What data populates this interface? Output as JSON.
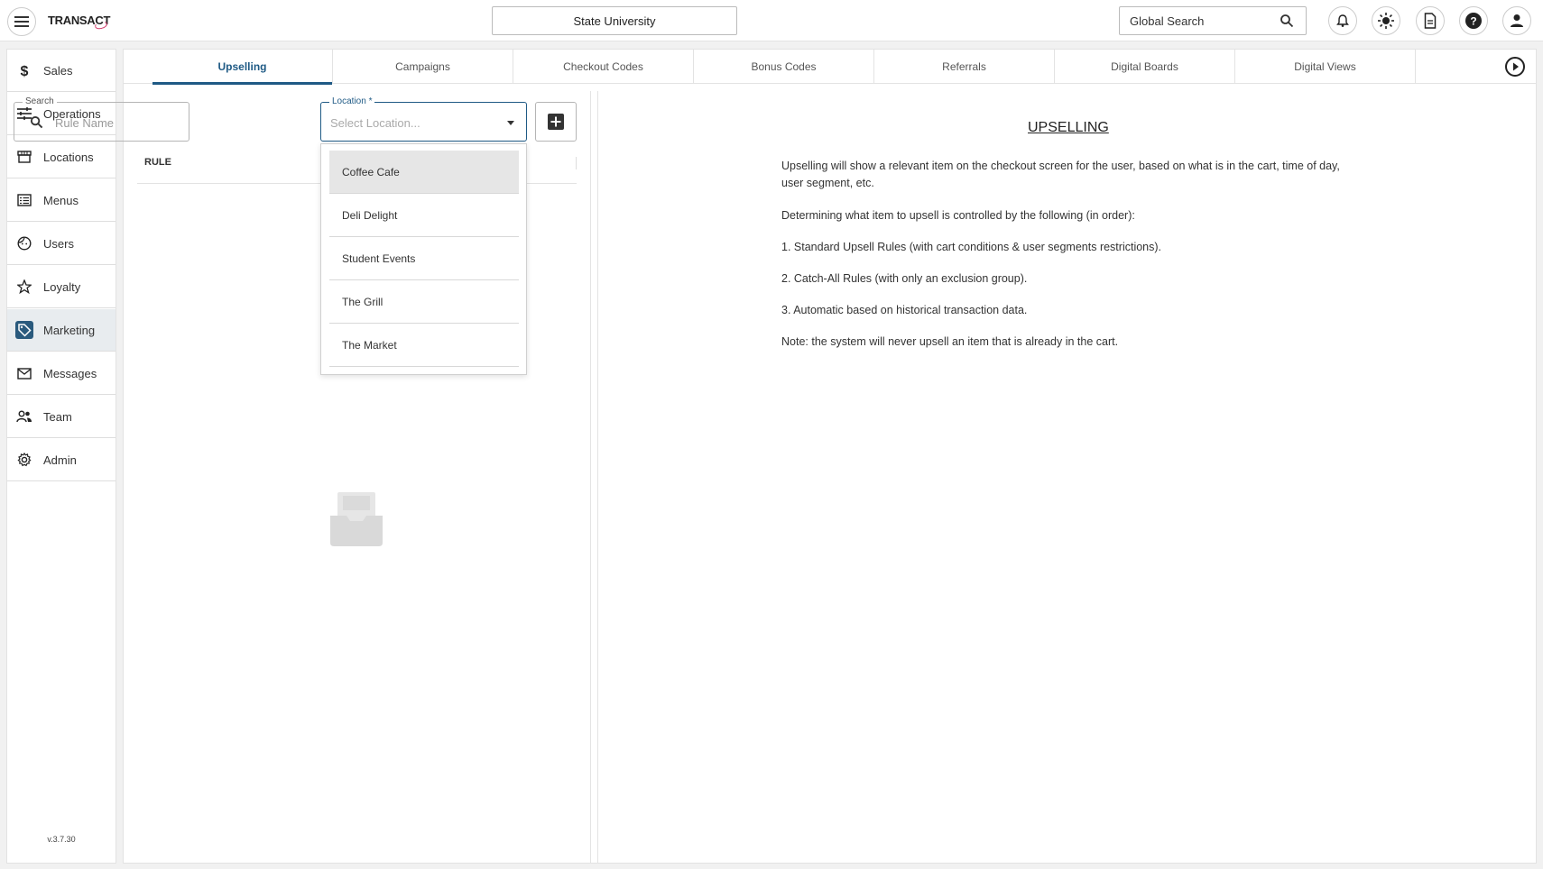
{
  "header": {
    "logo_text": "TRANSACT",
    "org_name": "State University",
    "global_search_placeholder": "Global Search"
  },
  "sidebar": {
    "items": [
      {
        "label": "Sales",
        "icon": "dollar-icon"
      },
      {
        "label": "Operations",
        "icon": "sliders-icon"
      },
      {
        "label": "Locations",
        "icon": "storefront-icon"
      },
      {
        "label": "Menus",
        "icon": "list-icon"
      },
      {
        "label": "Users",
        "icon": "face-icon"
      },
      {
        "label": "Loyalty",
        "icon": "star-icon"
      },
      {
        "label": "Marketing",
        "icon": "tag-icon",
        "active": true
      },
      {
        "label": "Messages",
        "icon": "mail-icon"
      },
      {
        "label": "Team",
        "icon": "people-icon"
      },
      {
        "label": "Admin",
        "icon": "gear-icon"
      }
    ],
    "version": "v.3.7.30"
  },
  "tabs": [
    {
      "label": "Upselling",
      "active": true
    },
    {
      "label": "Campaigns"
    },
    {
      "label": "Checkout Codes"
    },
    {
      "label": "Bonus Codes"
    },
    {
      "label": "Referrals"
    },
    {
      "label": "Digital Boards"
    },
    {
      "label": "Digital Views"
    }
  ],
  "filters": {
    "search_label": "Search",
    "search_placeholder": "Rule Name",
    "location_label": "Location *",
    "location_placeholder": "Select Location..."
  },
  "table": {
    "column_rule": "RULE"
  },
  "location_options": [
    "Coffee Cafe",
    "Deli Delight",
    "Student Events",
    "The Grill",
    "The Market"
  ],
  "info": {
    "title": "UPSELLING",
    "p1": "Upselling will show a relevant item on the checkout screen for the user, based on what is in the cart, time of day, user segment, etc.",
    "p2": "Determining what item to upsell is controlled by the following (in order):",
    "p3": "1. Standard Upsell Rules (with cart conditions & user segments restrictions).",
    "p4": "2. Catch-All Rules (with only an exclusion group).",
    "p5": "3. Automatic based on historical transaction data.",
    "p6": "Note: the system will never upsell an item that is already in the cart."
  },
  "colors": {
    "accent": "#1f5a85",
    "active_nav_bg": "#e8ecef"
  }
}
